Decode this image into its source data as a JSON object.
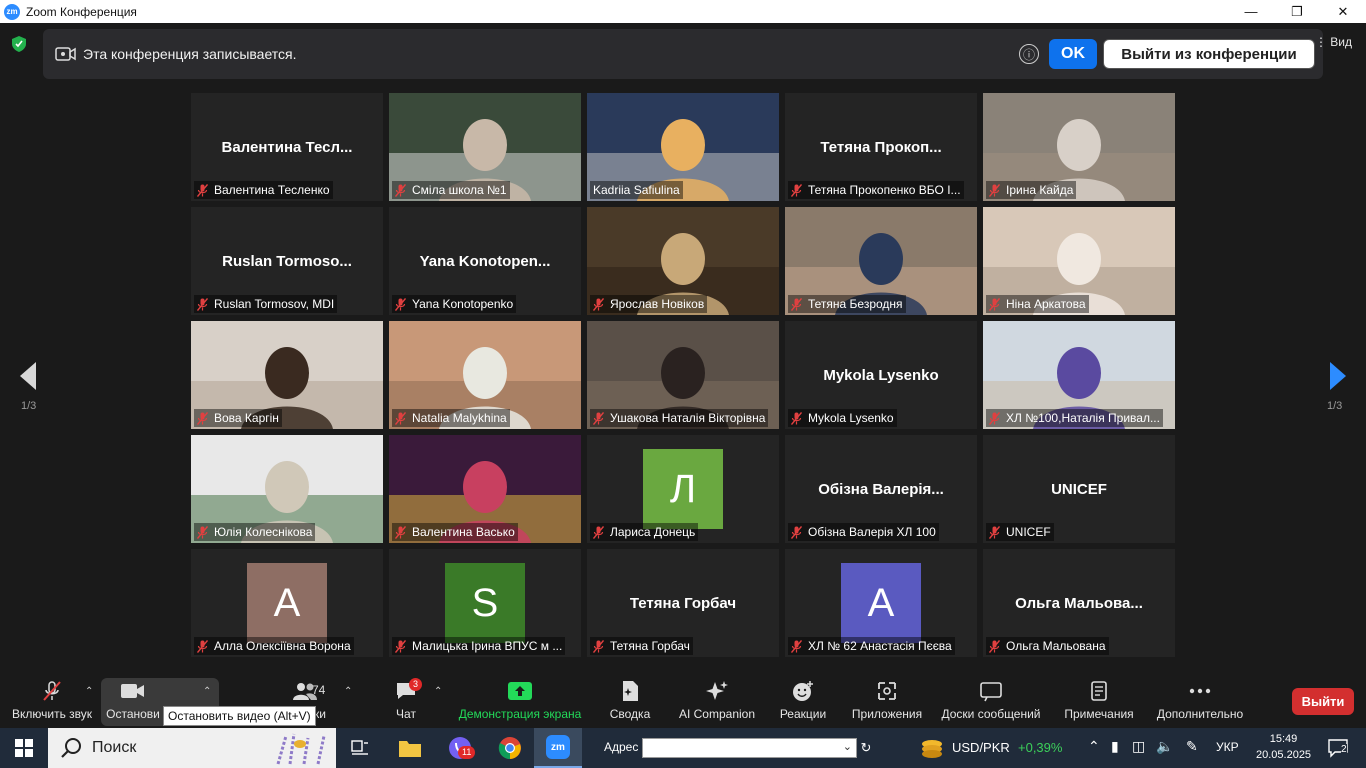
{
  "window": {
    "title": "Zoom Конференция",
    "logo": "zm"
  },
  "banner": {
    "text": "Эта конференция записывается.",
    "ok_label": "OK",
    "leave_label": "Выйти из конференции",
    "info_icon": "ⓘ"
  },
  "view_label": "Вид",
  "page_indicator": {
    "left": "1/3",
    "right": "1/3"
  },
  "tiles": [
    {
      "name": "Валентина Тесленко",
      "big": "Валентина  Тесл...",
      "type": "name"
    },
    {
      "name": "Сміла школа №1",
      "type": "video",
      "colors": [
        "#3a4a3a",
        "#c8b8a8",
        "#e0e0e0"
      ]
    },
    {
      "name": "Kadriia Safiulina",
      "type": "video",
      "colors": [
        "#2a3a5a",
        "#e8b060",
        "#c8c8c8"
      ],
      "active": true
    },
    {
      "name": "Тетяна Прокопенко ВБО І...",
      "big": "Тетяна  Прокоп...",
      "type": "name"
    },
    {
      "name": "Ірина Кайда",
      "type": "video",
      "colors": [
        "#8a8278",
        "#d8d0c8",
        "#a09080"
      ]
    },
    {
      "name": "Ruslan Tormosov, MDI",
      "big": "Ruslan  Tormoso...",
      "type": "name"
    },
    {
      "name": "Yana Konotopenko",
      "big": "Yana  Konotopen...",
      "type": "name"
    },
    {
      "name": "Ярослав Новіков",
      "type": "video",
      "colors": [
        "#4a3a28",
        "#c8a878",
        "#2a1e14"
      ]
    },
    {
      "name": "Тетяна Безродня",
      "type": "video",
      "colors": [
        "#8a7a6a",
        "#2a3a5a",
        "#c8a890"
      ]
    },
    {
      "name": "Ніна Аркатова",
      "type": "video",
      "colors": [
        "#d8c8b8",
        "#f0e8e0",
        "#a89888"
      ]
    },
    {
      "name": "Вова Каргін",
      "type": "video",
      "colors": [
        "#d8d0c8",
        "#3a2a20",
        "#b0a090"
      ]
    },
    {
      "name": "Natalia Malykhina",
      "type": "video",
      "colors": [
        "#c89878",
        "#e8e8e0",
        "#8a6850"
      ]
    },
    {
      "name": "Ушакова Наталія Вікторівна",
      "type": "video",
      "colors": [
        "#5a5048",
        "#2a2220",
        "#807060"
      ]
    },
    {
      "name": "Mykola Lysenko",
      "big": "Mykola Lysenko",
      "type": "name"
    },
    {
      "name": "ХЛ №100,Наталія Привал...",
      "type": "video",
      "colors": [
        "#d0d8e0",
        "#5a4aa0",
        "#c8b8a0"
      ]
    },
    {
      "name": "Юлія Колеснікова",
      "type": "video",
      "colors": [
        "#e8e8e8",
        "#d0c8b8",
        "#3a6a3a"
      ]
    },
    {
      "name": "Валентина Васько",
      "type": "video",
      "colors": [
        "#3a1a3a",
        "#c84060",
        "#e8c040"
      ]
    },
    {
      "name": "Лариса  Донець",
      "type": "avatar",
      "letter": "Л",
      "color": "#6aa840"
    },
    {
      "name": "Обізна Валерія ХЛ 100",
      "big": "Обізна  Валерія...",
      "type": "name"
    },
    {
      "name": "UNICEF",
      "big": "UNICEF",
      "type": "name"
    },
    {
      "name": "Алла Олексіївна Ворона",
      "type": "avatar",
      "letter": "A",
      "color": "#8e6e64"
    },
    {
      "name": "Малицька Ірина ВПУС м ...",
      "type": "avatar",
      "letter": "S",
      "color": "#3a7a28"
    },
    {
      "name": "Тетяна Горбач",
      "big": "Тетяна Горбач",
      "type": "name"
    },
    {
      "name": "ХЛ № 62 Анастасія Пєєва",
      "type": "avatar",
      "letter": "A",
      "color": "#5a5ac0"
    },
    {
      "name": "Ольга Мальована",
      "big": "Ольга  Мальова...",
      "type": "name"
    }
  ],
  "toolbar": {
    "audio_label": "Включить звук",
    "video_label": "Останови",
    "participants_count": "74",
    "participants_label_tail": "ки",
    "chat_label": "Чат",
    "chat_badge": "3",
    "share_label": "Демонстрация экрана",
    "share_color": "#23d959",
    "summary_label": "Сводка",
    "ai_label": "AI Companion",
    "reactions_label": "Реакции",
    "apps_label": "Приложения",
    "boards_label": "Доски сообщений",
    "notes_label": "Примечания",
    "more_label": "Дополнительно",
    "leave_label": "Выйти",
    "tooltip": "Остановить видео (Alt+V)"
  },
  "taskbar": {
    "search_placeholder": "Поиск",
    "viber_badge": "11",
    "address_label": "Адрес",
    "currency": "USD/PKR",
    "currency_change": "+0,39%",
    "lang": "УКР",
    "time": "15:49",
    "date": "20.05.2025",
    "notif_count": "2"
  }
}
